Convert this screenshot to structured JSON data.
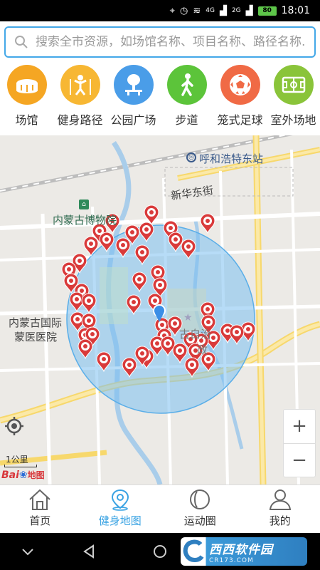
{
  "status": {
    "time": "18:01",
    "battery": "80",
    "net1": "4G",
    "net2": "2G"
  },
  "search": {
    "placeholder": "搜索全市资源，如场馆名称、项目名称、路径名称..."
  },
  "categories": [
    {
      "label": "场馆",
      "icon": "stadium-icon",
      "color": "#f5a623"
    },
    {
      "label": "健身路径",
      "icon": "fitness-person-icon",
      "color": "#f7b733"
    },
    {
      "label": "公园广场",
      "icon": "park-tree-icon",
      "color": "#4a9de8"
    },
    {
      "label": "步道",
      "icon": "walking-icon",
      "color": "#5cc43a"
    },
    {
      "label": "笼式足球",
      "icon": "soccer-ball-icon",
      "color": "#f06a45"
    },
    {
      "label": "室外场地",
      "icon": "field-icon",
      "color": "#8ac43a"
    }
  ],
  "map": {
    "labels": {
      "station": "呼和浩特东站",
      "street": "新华东街",
      "museum": "内蒙古博物院",
      "hospital_line1": "内蒙古国际",
      "hospital_line2": "蒙医医院",
      "gov_partial1": "古自治",
      "gov_partial2": "政"
    },
    "scale": "1公里",
    "zoom_in": "+",
    "zoom_out": "−",
    "logo_text_1": "Bai",
    "logo_text_2": "地图"
  },
  "tabs": [
    {
      "label": "首页",
      "icon": "home-icon",
      "active": false
    },
    {
      "label": "健身地图",
      "icon": "map-pin-icon",
      "active": true
    },
    {
      "label": "运动圈",
      "icon": "circle-icon",
      "active": false
    },
    {
      "label": "我的",
      "icon": "profile-icon",
      "active": false
    }
  ],
  "watermark": {
    "line1": "西西软件园",
    "line2": "CR173.COM"
  },
  "colors": {
    "accent": "#3aa3e3",
    "marker": "#d93a3a",
    "radius_fill": "#7cc0f0"
  }
}
